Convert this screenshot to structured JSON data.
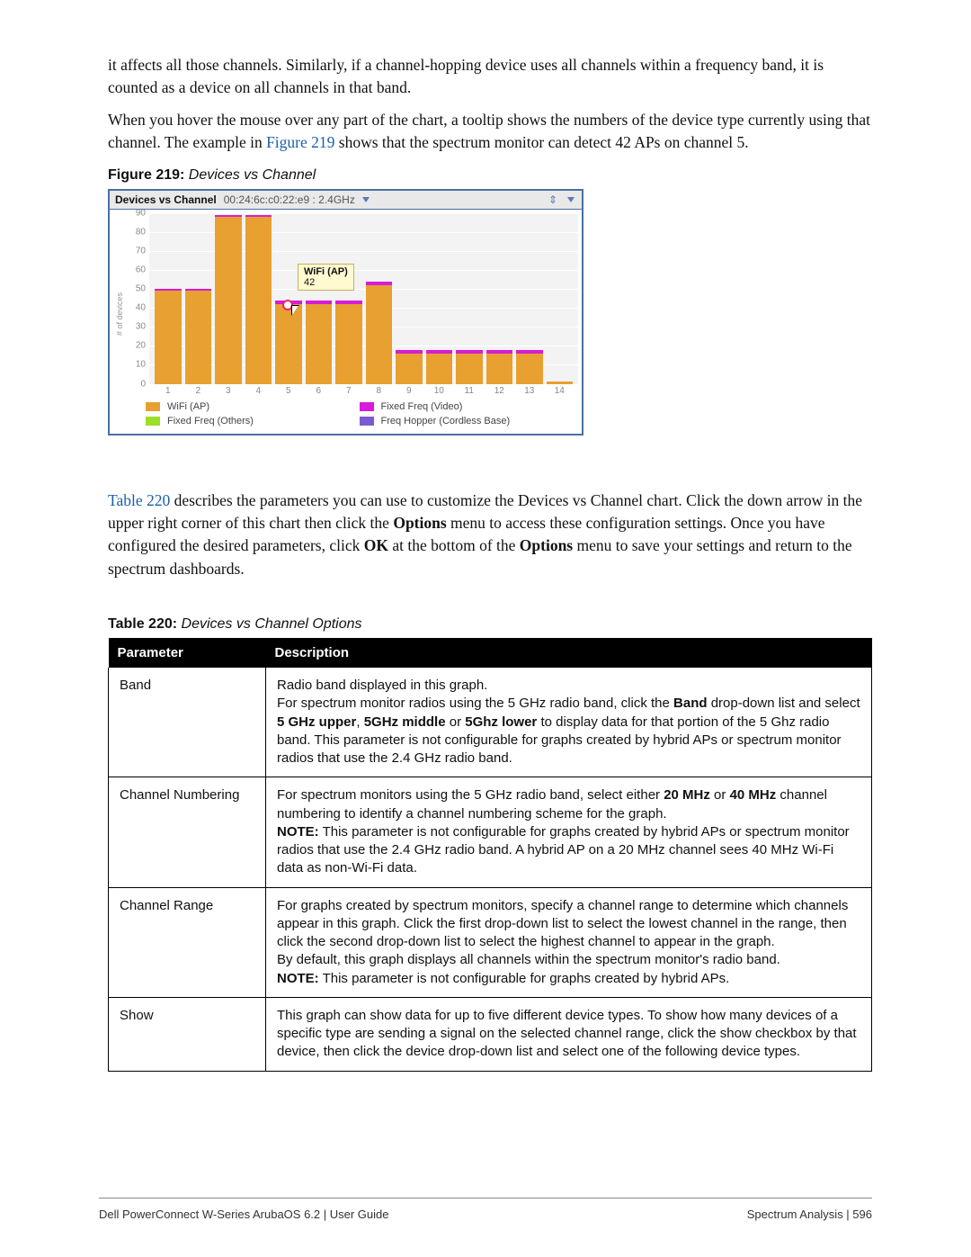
{
  "intro1": "it affects all those channels. Similarly, if a channel-hopping device uses all channels within a frequency band, it is counted as a device on all channels in that band.",
  "intro2a": "When you hover the mouse over any part of the chart, a tooltip shows the numbers of the device type currently using that channel. The example in ",
  "intro2_link": "Figure 219",
  "intro2b": " shows that the spectrum monitor can detect 42 APs on channel 5.",
  "fig_caption_label": "Figure 219:",
  "fig_caption_title": " Devices vs Channel",
  "chart_header": {
    "title": "Devices vs Channel",
    "mac": "00:24:6c:c0:22:e9 : 2.4GHz"
  },
  "tooltip": {
    "title": "WiFi (AP)",
    "value": "42"
  },
  "legend": {
    "wifi": "WiFi (AP)",
    "video": "Fixed Freq (Video)",
    "others": "Fixed Freq (Others)",
    "cordless": "Freq Hopper (Cordless Base)"
  },
  "mid1a": "",
  "mid_link": "Table 220",
  "mid1b": " describes the parameters you can use to customize the Devices vs Channel chart. Click the down arrow in the upper right corner of this chart then click the ",
  "mid_bold1": "Options",
  "mid1c": " menu to access these configuration settings. Once you have configured the desired parameters, click ",
  "mid_bold2": "OK",
  "mid1d": " at the bottom of the ",
  "mid_bold3": "Options",
  "mid1e": " menu to save your settings and return to the spectrum dashboards.",
  "table_caption_label": "Table 220:",
  "table_caption_title": " Devices vs Channel Options",
  "table": {
    "h1": "Parameter",
    "h2": "Description",
    "rows": [
      {
        "p": "Band",
        "d_a": "Radio band displayed in this graph.\nFor spectrum monitor radios using the 5 GHz radio band, click the ",
        "d_b1": "Band",
        "d_b": " drop-down list and select ",
        "d_b2": "5 GHz upper",
        "d_c": ", ",
        "d_b3": "5GHz middle",
        "d_d": " or ",
        "d_b4": "5Ghz lower",
        "d_e": " to display data for that portion of the 5 Ghz radio band. This parameter is not configurable for graphs created by hybrid APs or spectrum monitor radios that use the 2.4 GHz radio band."
      },
      {
        "p": "Channel Numbering",
        "d_a": "For spectrum monitors using the 5 GHz radio band, select either ",
        "d_b1": "20 MHz",
        "d_b": " or ",
        "d_b2": "40 MHz",
        "d_c": " channel numbering to identify a channel numbering scheme for the graph.\n",
        "d_b3": "NOTE:",
        "d_d": " This parameter is not configurable for graphs created by hybrid APs or spectrum monitor radios that use the 2.4 GHz radio band. A hybrid AP on a 20 MHz channel sees 40 MHz Wi-Fi data as non-Wi-Fi data."
      },
      {
        "p": "Channel Range",
        "d_a": "For graphs created by spectrum monitors, specify a channel range to determine which channels appear in this graph. Click the first drop-down list to select the lowest channel in the range, then click the second drop-down list to select the highest channel to appear in the graph.\nBy default, this graph displays all channels within the spectrum monitor's radio band.\n",
        "d_b1": "NOTE:",
        "d_b": " This parameter is not configurable for graphs created by hybrid APs."
      },
      {
        "p": "Show",
        "d_a": "This graph can show data for up to five different device types. To show how many devices of a specific type are sending a signal on the selected channel range, click the show checkbox by that device, then click the device drop-down list and select one of the following device types."
      }
    ]
  },
  "footer_left": "Dell PowerConnect W-Series ArubaOS 6.2 | User Guide",
  "footer_right": "Spectrum Analysis | 596",
  "chart_data": {
    "type": "bar",
    "title": "Devices vs Channel",
    "xlabel": "",
    "ylabel": "# of devices",
    "ylim": [
      0,
      90
    ],
    "yticks": [
      0,
      10,
      20,
      30,
      40,
      50,
      60,
      70,
      80,
      90
    ],
    "categories": [
      1,
      2,
      3,
      4,
      5,
      6,
      7,
      8,
      9,
      10,
      11,
      12,
      13,
      14
    ],
    "series": [
      {
        "name": "WiFi (AP)",
        "color": "#e8a030",
        "values": [
          49,
          49,
          88,
          88,
          42,
          42,
          42,
          52,
          16,
          16,
          16,
          16,
          16,
          1
        ]
      },
      {
        "name": "Fixed Freq (Video)",
        "color": "#d81bd8",
        "values": [
          1,
          1,
          1,
          1,
          2,
          2,
          2,
          2,
          2,
          2,
          2,
          2,
          2,
          0
        ]
      },
      {
        "name": "Fixed Freq (Others)",
        "color": "#9be025",
        "values": [
          0,
          0,
          0,
          0,
          0,
          0,
          0,
          0,
          0,
          0,
          0,
          0,
          0,
          0
        ]
      },
      {
        "name": "Freq Hopper (Cordless Base)",
        "color": "#7a5bcf",
        "values": [
          0,
          0,
          0,
          0,
          0,
          0,
          0,
          0,
          0,
          0,
          0,
          0,
          0,
          0
        ]
      }
    ],
    "tooltip_point": {
      "category": 5,
      "series": "WiFi (AP)",
      "value": 42
    }
  }
}
